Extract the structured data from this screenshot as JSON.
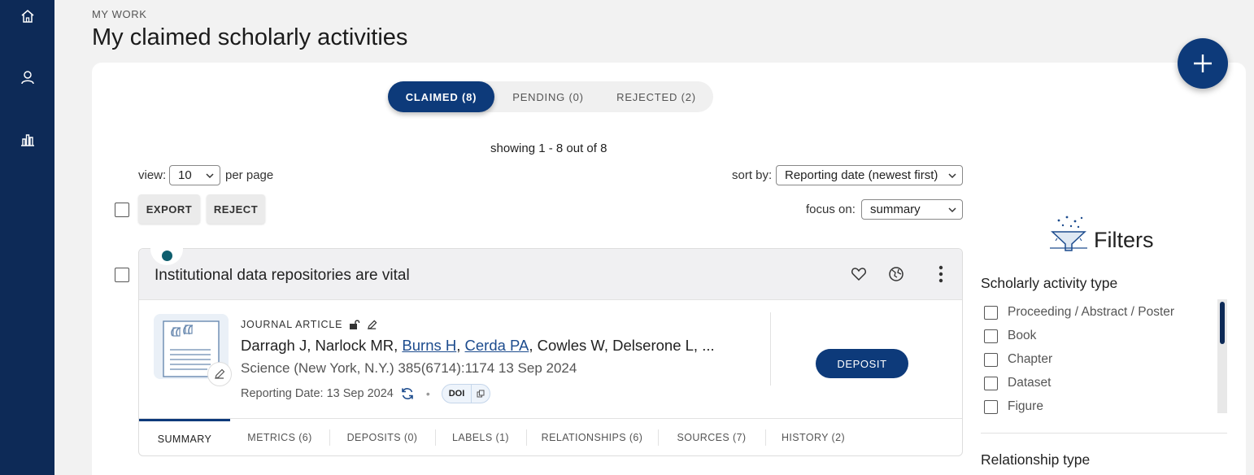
{
  "sidebar": {
    "items": [
      {
        "icon": "home-icon"
      },
      {
        "icon": "user-icon"
      },
      {
        "icon": "bar-chart-icon"
      }
    ],
    "bg_color": "#0d2a57"
  },
  "header": {
    "kicker": "MY WORK",
    "title": "My claimed scholarly activities"
  },
  "status_tabs": [
    {
      "label": "CLAIMED (8)",
      "active": true
    },
    {
      "label": "PENDING (0)",
      "active": false
    },
    {
      "label": "REJECTED (2)",
      "active": false
    }
  ],
  "results": {
    "showing": "showing 1 - 8 out of 8"
  },
  "controls": {
    "view_label": "view:",
    "view_value": "10",
    "per_page_label": "per page",
    "sort_label": "sort by:",
    "sort_value": "Reporting date (newest first)",
    "focus_label": "focus on:",
    "focus_value": "summary",
    "export_label": "EXPORT",
    "reject_label": "REJECT"
  },
  "item": {
    "title": "Institutional data repositories are vital",
    "type": "JOURNAL ARTICLE",
    "authors": {
      "prefix": "Darragh J, Narlock MR, ",
      "link1": "Burns H",
      "sep": ", ",
      "link2": "Cerda PA",
      "suffix": ", Cowles W, Delserone L, ..."
    },
    "venue": "Science (New York, N.Y.) 385(6714):1174 13 Sep 2024",
    "reporting_date": "Reporting Date: 13 Sep 2024",
    "doi_label": "DOI",
    "deposit_label": "DEPOSIT",
    "tabs": [
      {
        "label": "SUMMARY",
        "active": true
      },
      {
        "label": "METRICS (6)",
        "active": false
      },
      {
        "label": "DEPOSITS (0)",
        "active": false
      },
      {
        "label": "LABELS (1)",
        "active": false
      },
      {
        "label": "RELATIONSHIPS (6)",
        "active": false
      },
      {
        "label": "SOURCES (7)",
        "active": false
      },
      {
        "label": "HISTORY (2)",
        "active": false
      }
    ]
  },
  "filters": {
    "title": "Filters",
    "activity_type_heading": "Scholarly activity type",
    "activity_types": [
      "Proceeding / Abstract / Poster",
      "Book",
      "Chapter",
      "Dataset",
      "Figure"
    ],
    "relationship_heading": "Relationship type"
  },
  "colors": {
    "primary": "#0d3a7a",
    "status_dot": "#0e5e6e",
    "link": "#1d4c8e"
  }
}
